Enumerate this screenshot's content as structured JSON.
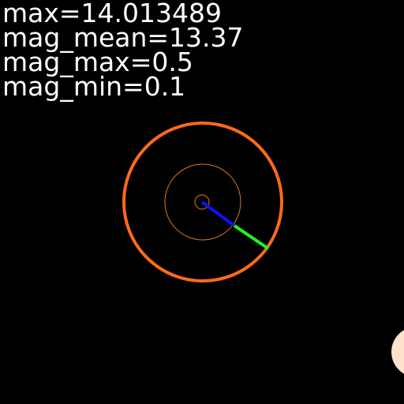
{
  "readouts": [
    {
      "id": "max",
      "text": "max=14.013489"
    },
    {
      "id": "mag_mean",
      "text": "mag_mean=13.37"
    },
    {
      "id": "mag_max",
      "text": "mag_max=0.5"
    },
    {
      "id": "mag_min",
      "text": "mag_min=0.1"
    }
  ],
  "colors": {
    "background": "#000000",
    "text": "#ffffff",
    "outer_ring": "#ff6a1a",
    "inner_ring": "#d9781f",
    "center_ring": "#d9661a",
    "blue_vector": "#0a14ff",
    "green_vector": "#1aff1a",
    "edge_marker": "#ffe1cc"
  }
}
